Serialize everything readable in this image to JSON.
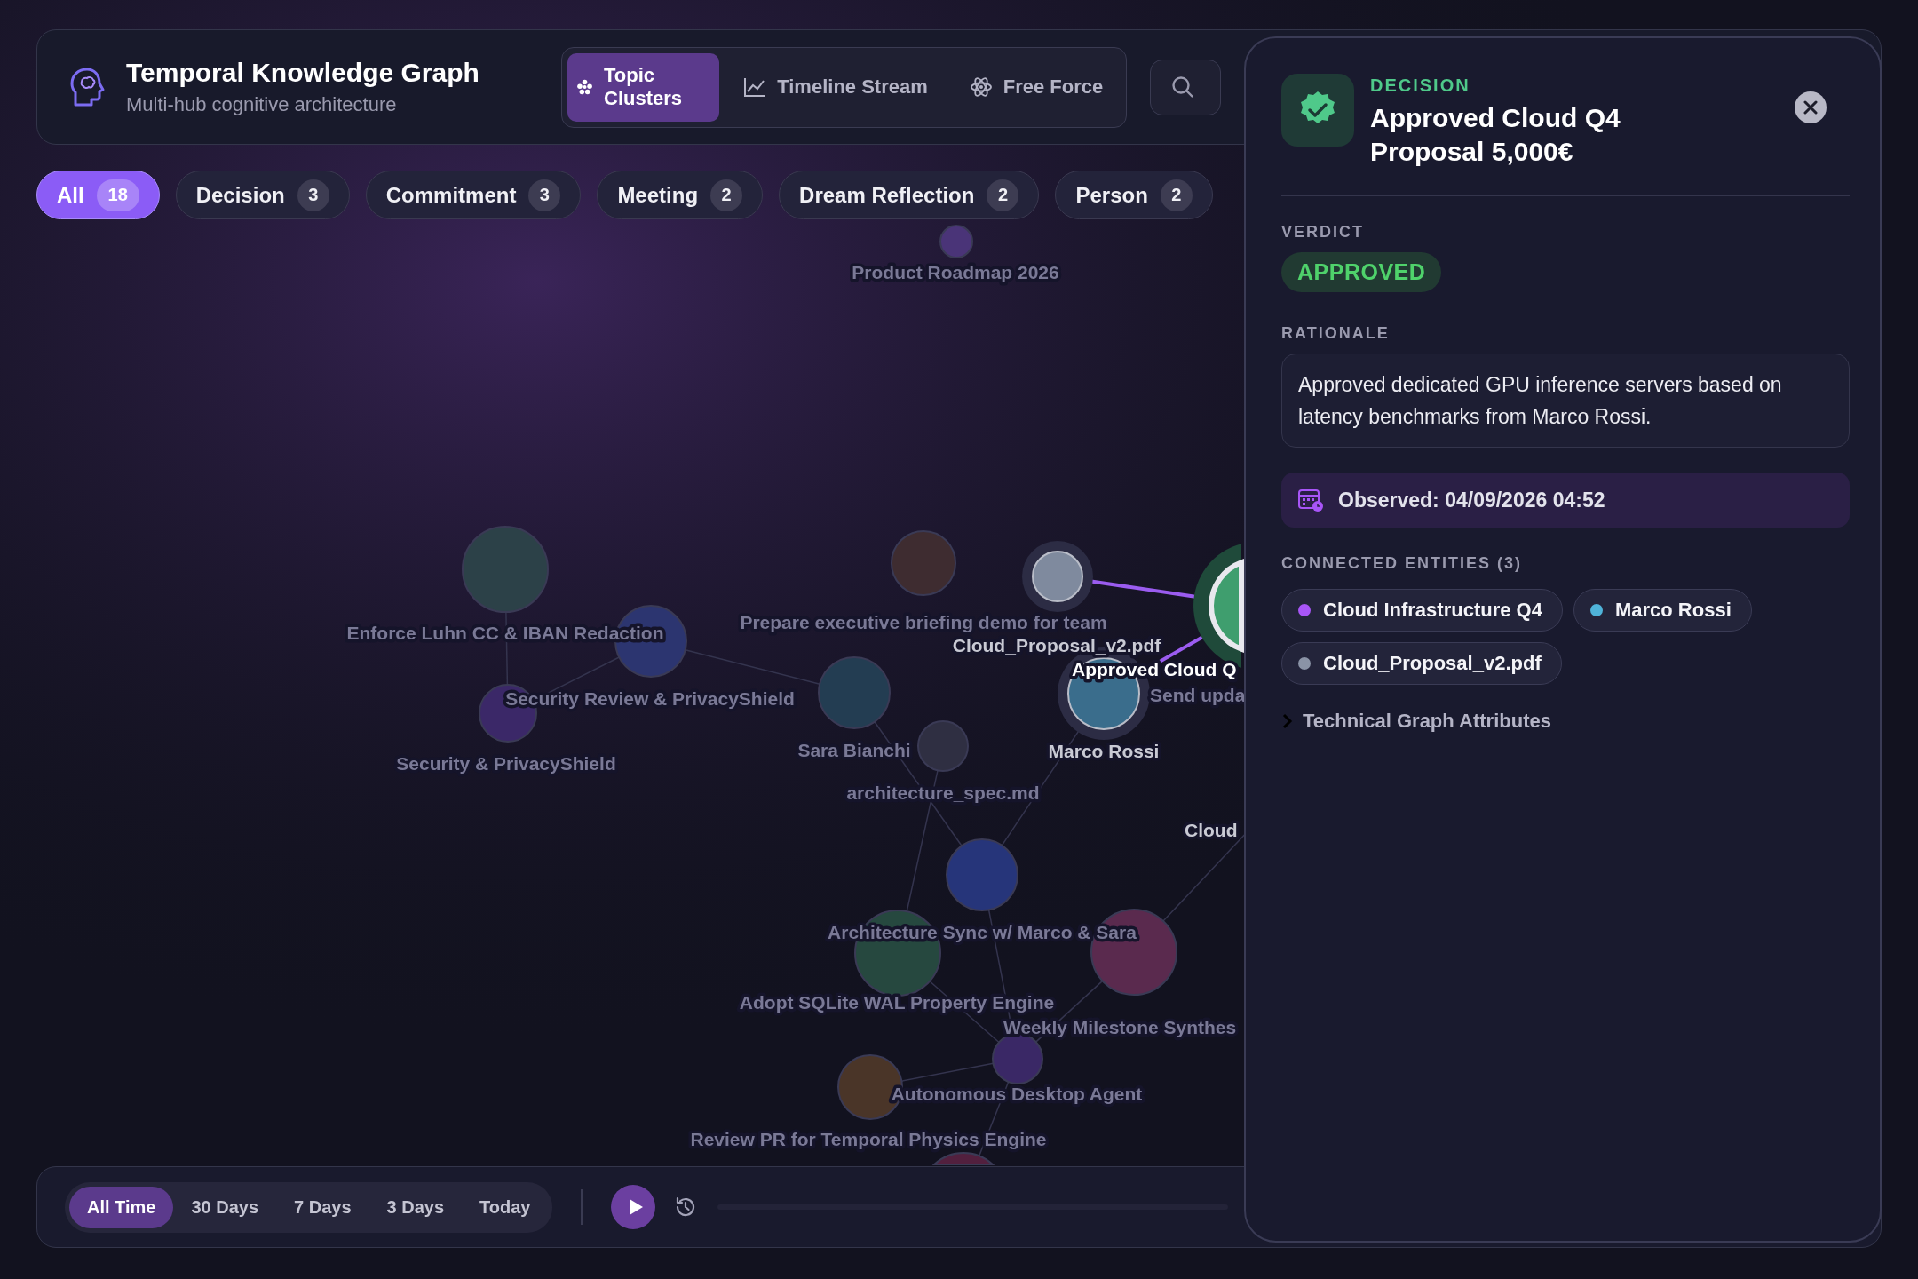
{
  "app": {
    "title": "Temporal Knowledge Graph",
    "subtitle": "Multi-hub cognitive architecture"
  },
  "view_modes": [
    {
      "label": "Topic Clusters",
      "selected": true,
      "kind": "clusters"
    },
    {
      "label": "Timeline Stream",
      "selected": false,
      "kind": "timeline"
    },
    {
      "label": "Free Force",
      "selected": false,
      "kind": "force"
    }
  ],
  "filters": [
    {
      "label": "All",
      "count": "18",
      "selected": true
    },
    {
      "label": "Decision",
      "count": "3",
      "selected": false
    },
    {
      "label": "Commitment",
      "count": "3",
      "selected": false
    },
    {
      "label": "Meeting",
      "count": "2",
      "selected": false
    },
    {
      "label": "Dream Reflection",
      "count": "2",
      "selected": false
    },
    {
      "label": "Person",
      "count": "2",
      "selected": false
    }
  ],
  "graph": {
    "nodes": [
      {
        "label": "Product Roadmap 2026",
        "color": "#4a3478",
        "selected": false,
        "dimmed": true
      },
      {
        "label": "Enforce Luhn CC & IBAN Redaction",
        "color": "#2c4148",
        "selected": false,
        "dimmed": true
      },
      {
        "label": "Prepare executive briefing demo for team",
        "color": "#3e2c30",
        "selected": false,
        "dimmed": true
      },
      {
        "label": "Cloud_Proposal_v2.pdf",
        "color": "#7f8a9e",
        "selected": false,
        "dimmed": false
      },
      {
        "label": "Approved Cloud Q",
        "color": "#3f9e6e",
        "selected": true,
        "dimmed": false
      },
      {
        "label": "Security Review & PrivacyShield",
        "color": "#2c3570",
        "selected": false,
        "dimmed": true
      },
      {
        "label": "Sara Bianchi",
        "color": "#233d52",
        "selected": false,
        "dimmed": true
      },
      {
        "label": "Marco Rossi",
        "color": "#3a6d8c",
        "selected": false,
        "dimmed": false
      },
      {
        "label": "Send upda",
        "dimmed": true
      },
      {
        "label": "Security & PrivacyShield",
        "color": "#3b2868",
        "selected": false,
        "dimmed": true
      },
      {
        "label": "architecture_spec.md",
        "color": "#2f2f42",
        "selected": false,
        "dimmed": true
      },
      {
        "label": "Cloud",
        "dimmed": false
      },
      {
        "label": "Architecture Sync w/ Marco & Sara",
        "color": "#26357a",
        "selected": false,
        "dimmed": true
      },
      {
        "label": "Adopt SQLite WAL Property Engine",
        "color": "#26483f",
        "selected": false,
        "dimmed": true
      },
      {
        "label": "Weekly Milestone Synthes",
        "color": "#5a2a4e",
        "selected": false,
        "dimmed": true
      },
      {
        "label": "Autonomous Desktop Agent",
        "color": "#3a2866",
        "selected": false,
        "dimmed": true
      },
      {
        "label": "Review PR for Temporal Physics Engine",
        "color": "#4a3528",
        "selected": false,
        "dimmed": true
      },
      {
        "color": "#52203e",
        "selected": false,
        "dimmed": true
      }
    ]
  },
  "timeline": {
    "ranges": [
      {
        "label": "All Time",
        "selected": true
      },
      {
        "label": "30 Days",
        "selected": false
      },
      {
        "label": "7 Days",
        "selected": false
      },
      {
        "label": "3 Days",
        "selected": false
      },
      {
        "label": "Today",
        "selected": false
      }
    ],
    "playing": false
  },
  "detail": {
    "type": "DECISION",
    "title": "Approved Cloud Q4 Proposal 5,000€",
    "verdict_label": "VERDICT",
    "verdict": "APPROVED",
    "rationale_label": "RATIONALE",
    "rationale": "Approved dedicated GPU inference servers based on latency benchmarks from Marco Rossi.",
    "observed": "Observed: 04/09/2026 04:52",
    "connected_label": "CONNECTED ENTITIES (3)",
    "connected": [
      {
        "label": "Cloud Infrastructure Q4",
        "color": "#a855f7"
      },
      {
        "label": "Marco Rossi",
        "color": "#4fb3d9"
      },
      {
        "label": "Cloud_Proposal_v2.pdf",
        "color": "#8a93a6"
      }
    ],
    "technical": {
      "label": "Technical Graph Attributes",
      "expanded": false
    }
  }
}
